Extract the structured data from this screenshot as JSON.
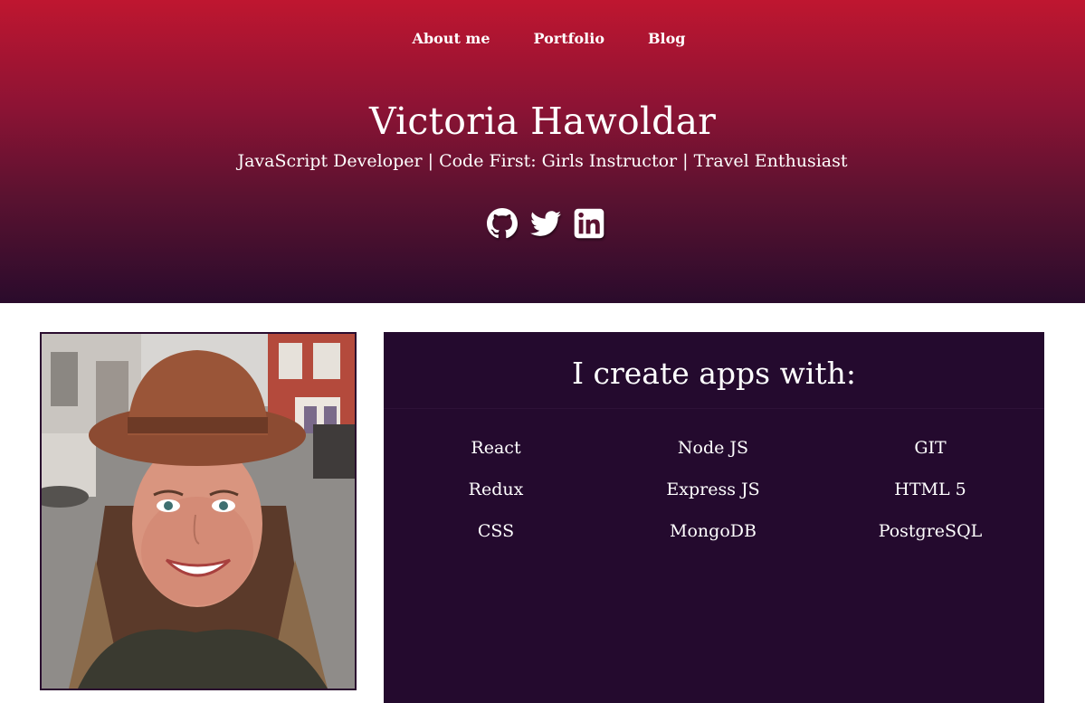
{
  "nav": {
    "items": [
      "About me",
      "Portfolio",
      "Blog"
    ]
  },
  "hero": {
    "name": "Victoria Hawoldar",
    "tagline": "JavaScript Developer | Code First: Girls Instructor | Travel Enthusiast"
  },
  "socials": {
    "icons": [
      "github-icon",
      "twitter-icon",
      "linkedin-icon"
    ]
  },
  "skills": {
    "title": "I create apps with:",
    "items": [
      "React",
      "Node JS",
      "GIT",
      "Redux",
      "Express JS",
      "HTML 5",
      "CSS",
      "MongoDB",
      "PostgreSQL"
    ]
  },
  "colors": {
    "header_top": "#bf1630",
    "header_bottom": "#2a0b2c",
    "panel": "#240a2e",
    "text": "#ffffff"
  }
}
